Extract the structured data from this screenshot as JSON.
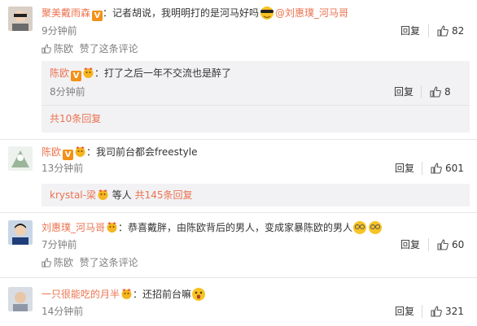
{
  "comments": [
    {
      "user": "聚美戴雨森",
      "text": "：记者胡说，我明明打的是河马好吗",
      "mention": "@刘惠璞_河马哥",
      "time": "9分钟前",
      "reply_label": "回复",
      "likes": "82",
      "liked_by": "陈欧",
      "liked_suffix": "赞了这条评论",
      "sub_reply": {
        "user": "陈欧",
        "text": "：打了之后一年不交流也是醉了",
        "time": "8分钟前",
        "reply_label": "回复",
        "likes": "8"
      },
      "more_replies": "共10条回复"
    },
    {
      "user": "陈欧",
      "text": "：我司前台都会freestyle",
      "time": "13分钟前",
      "reply_label": "回复",
      "likes": "601",
      "reply_preview_user": "krystal-梁",
      "reply_preview_text": "等人",
      "reply_preview_count": "共145条回复"
    },
    {
      "user": "刘惠璞_河马哥",
      "text": "：恭喜戴胖，由陈欧背后的男人，变成家暴陈欧的男人",
      "time": "7分钟前",
      "reply_label": "回复",
      "likes": "60",
      "liked_by": "陈欧",
      "liked_suffix": "赞了这条评论"
    },
    {
      "user": "一只很能吃的月半",
      "text": "：还招前台嘛",
      "time": "14分钟前",
      "reply_label": "回复",
      "likes": "321"
    }
  ],
  "icons": {
    "like": "thumbs-up-icon",
    "liked_by": "thumbs-up-small-icon",
    "verified": "verified-v-badge-icon",
    "medal": "member-medal-icon"
  },
  "colors": {
    "username": "#eb7350",
    "text": "#333333",
    "muted": "#808080",
    "sub_bg": "#f2f2f5"
  }
}
